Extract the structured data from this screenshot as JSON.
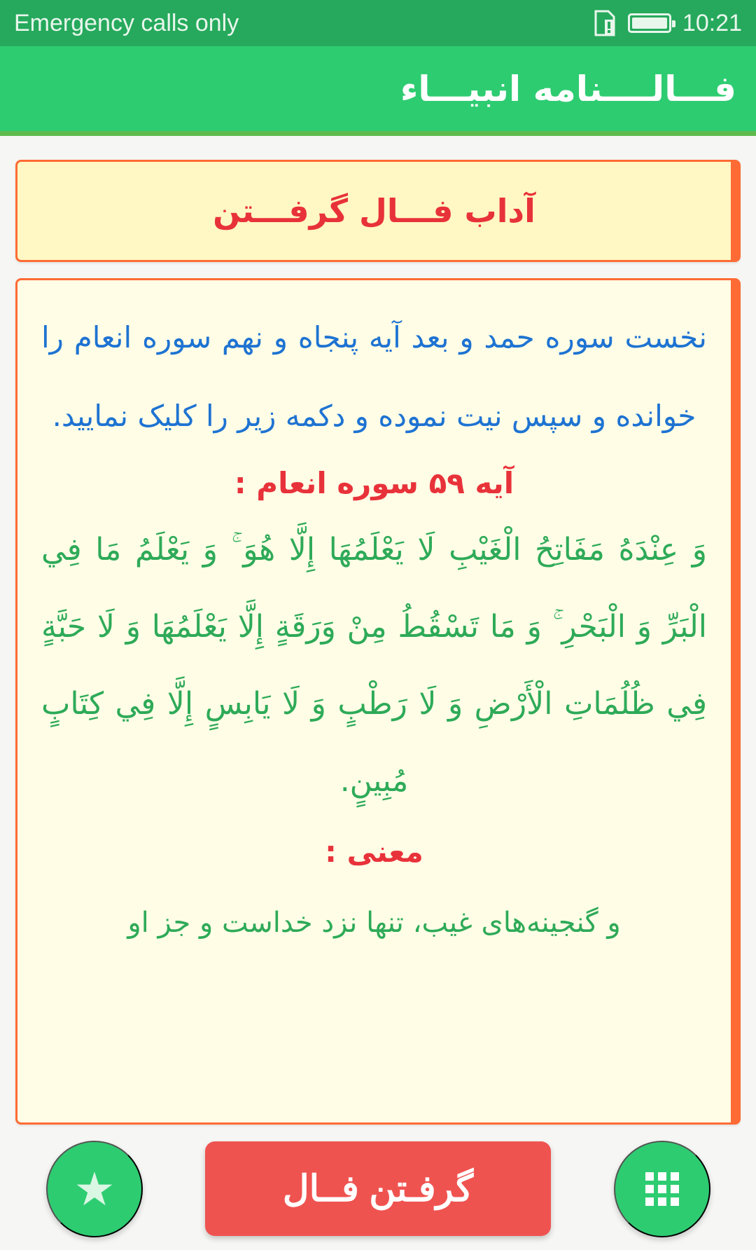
{
  "status_bar": {
    "carrier_text": "Emergency calls only",
    "time": "10:21",
    "icons": [
      "sim-alert-icon",
      "battery-icon"
    ]
  },
  "app_bar": {
    "title": "فـــالــــنامه انبیـــاء"
  },
  "header_card": {
    "title": "آداب فـــال گرفـــتن"
  },
  "content": {
    "instruction": "نخست سوره حمد و بعد آیه پنجاه و نهم سوره انعام را خوانده و سپس نیت نموده و دکمه زیر را کلیک نمایید.",
    "verse_heading": "آیه ۵۹ سوره انعام :",
    "verse_text": "وَ عِنْدَهُ مَفَاتِحُ الْغَيْبِ لَا يَعْلَمُهَا إِلَّا هُوَ ۚ وَ يَعْلَمُ مَا فِي الْبَرِّ وَ الْبَحْرِ ۚ وَ مَا تَسْقُطُ مِنْ وَرَقَةٍ إِلَّا يَعْلَمُهَا وَ لَا حَبَّةٍ فِي ظُلُمَاتِ الْأَرْضِ وَ لَا رَطْبٍ وَ لَا يَابِسٍ إِلَّا فِي كِتَابٍ مُبِينٍ.",
    "meaning_heading": "معنی :",
    "meaning_text": "و گنجینه‌های غیب، تنها نزد خداست و جز او"
  },
  "bottom_bar": {
    "fal_button_label": "گرفـتن فــال",
    "left_fab_icon": "star-icon",
    "right_fab_icon": "apps-grid-icon"
  },
  "colors": {
    "status_bar": "#26a95c",
    "app_bar": "#2ecc71",
    "card_border": "#ff6b35",
    "header_card_bg": "#fff7c4",
    "content_card_bg": "#fffde6",
    "red_text": "#e8323a",
    "blue_text": "#1e73d2",
    "green_text": "#2eaa58",
    "fal_button": "#ef5350"
  }
}
